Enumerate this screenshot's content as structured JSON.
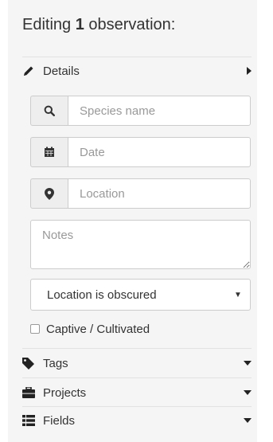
{
  "header": {
    "prefix": "Editing",
    "count": "1",
    "suffix": "observation:"
  },
  "details": {
    "label": "Details",
    "icon": "pencil-icon"
  },
  "fields_form": {
    "species": {
      "placeholder": "Species name",
      "icon": "search-icon"
    },
    "date": {
      "placeholder": "Date",
      "icon": "calendar-icon"
    },
    "location": {
      "placeholder": "Location",
      "icon": "map-marker-icon"
    },
    "notes": {
      "placeholder": "Notes"
    },
    "geoprivacy": {
      "selected": "Location is obscured"
    },
    "captive": {
      "label": "Captive / Cultivated",
      "checked": false
    }
  },
  "sections": {
    "tags": {
      "label": "Tags",
      "icon": "tag-icon"
    },
    "projects": {
      "label": "Projects",
      "icon": "briefcase-icon"
    },
    "fields": {
      "label": "Fields",
      "icon": "list-icon"
    }
  },
  "colors": {
    "panel_bg": "#f5f5f5",
    "border": "#cccccc",
    "addon_bg": "#eeeeee",
    "text": "#333333",
    "placeholder": "#999999"
  }
}
